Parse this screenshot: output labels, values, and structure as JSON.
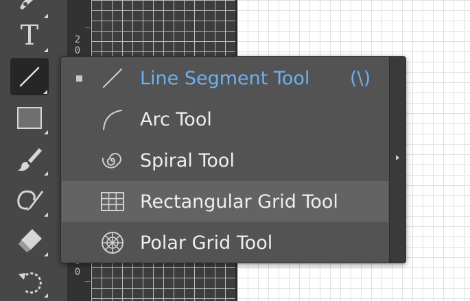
{
  "ruler": {
    "top_digits": [
      "2",
      "0"
    ],
    "bottom_digits": [
      "0",
      "0"
    ]
  },
  "toolbar": {
    "tools": [
      {
        "name": "shaper",
        "icon": "pen-curl-icon"
      },
      {
        "name": "type",
        "icon": "type-icon",
        "label": "T"
      },
      {
        "name": "line-segment",
        "icon": "line-segment-icon",
        "active": true
      },
      {
        "name": "rectangle",
        "icon": "rectangle-icon"
      },
      {
        "name": "paintbrush",
        "icon": "paintbrush-icon"
      },
      {
        "name": "shaper-pencil",
        "icon": "shaper-icon"
      },
      {
        "name": "eraser",
        "icon": "eraser-icon"
      },
      {
        "name": "rotate",
        "icon": "rotate-icon"
      }
    ]
  },
  "flyout": {
    "items": [
      {
        "label": "Line Segment Tool",
        "shortcut": "(\\)",
        "icon": "line-segment-icon",
        "selected": true
      },
      {
        "label": "Arc Tool",
        "icon": "arc-icon"
      },
      {
        "label": "Spiral Tool",
        "icon": "spiral-icon"
      },
      {
        "label": "Rectangular Grid Tool",
        "icon": "rectangular-grid-icon",
        "hover": true
      },
      {
        "label": "Polar Grid Tool",
        "icon": "polar-grid-icon"
      }
    ],
    "submenu_arrow_icon": "chevron-right-icon"
  },
  "colors": {
    "selected_text": "#6cb0f5",
    "menu_bg": "#535353",
    "hover_bg": "#636363",
    "toolbar_bg": "#474747"
  }
}
